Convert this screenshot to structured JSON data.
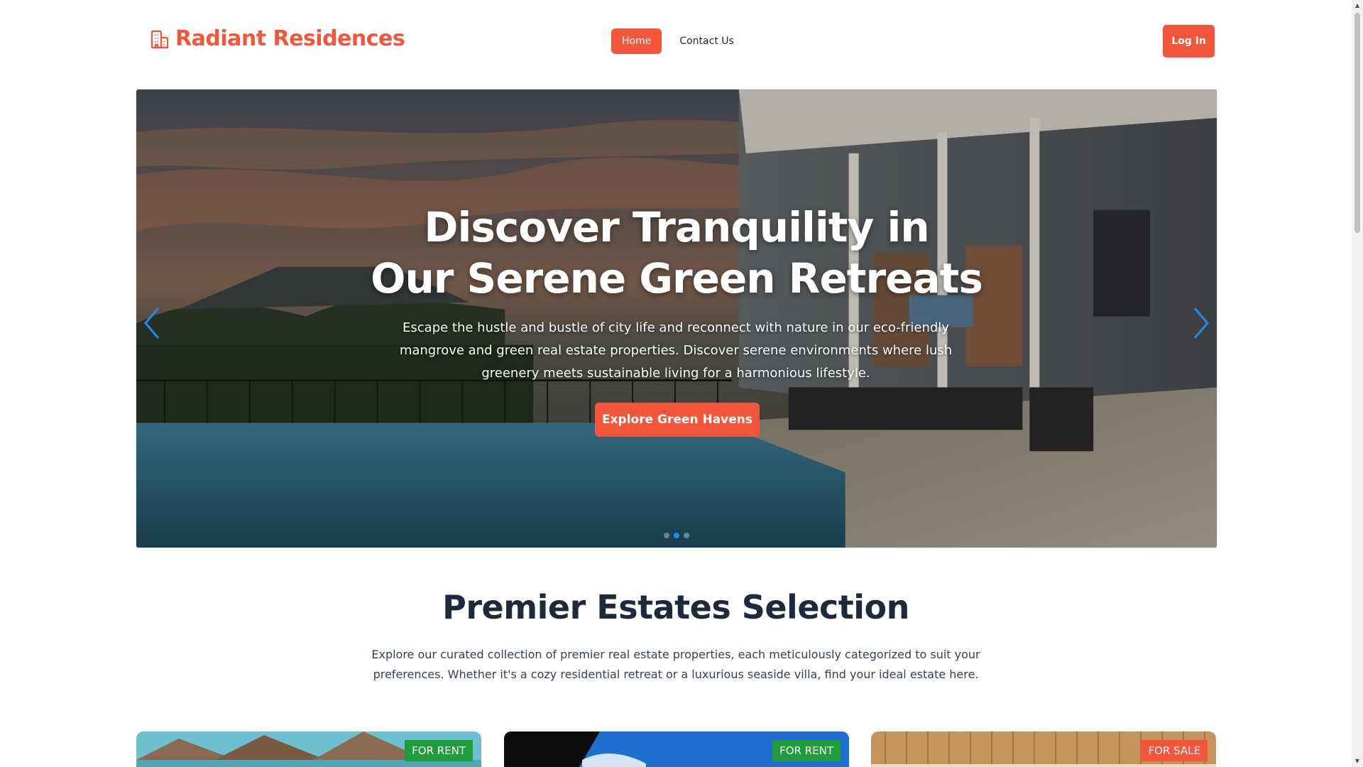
{
  "brand": {
    "name": "Radiant Residences",
    "icon": "building-icon",
    "color": "#f4563b"
  },
  "nav": {
    "items": [
      {
        "label": "Home",
        "active": true
      },
      {
        "label": "Contact Us",
        "active": false
      }
    ],
    "login_label": "Log In"
  },
  "hero": {
    "title_line1": "Discover Tranquility in",
    "title_line2": "Our Serene Green Retreats",
    "subtitle": "Escape the hustle and bustle of city life and reconnect with nature in our eco-friendly mangrove and green real estate properties. Discover serene environments where lush greenery meets sustainable living for a harmonious lifestyle.",
    "cta_label": "Explore Green Havens",
    "slide_count": 3,
    "active_slide": 2
  },
  "premier": {
    "title": "Premier Estates Selection",
    "description": "Explore our curated collection of premier real estate properties, each meticulously categorized to suit your preferences. Whether it's a cozy residential retreat or a luxurious seaside villa, find your ideal estate here."
  },
  "listings": [
    {
      "badge": "FOR RENT",
      "status": "rent"
    },
    {
      "badge": "FOR RENT",
      "status": "rent"
    },
    {
      "badge": "FOR SALE",
      "status": "sale"
    }
  ],
  "colors": {
    "accent": "#f4563b",
    "rent_badge": "#1f9d3a",
    "dot_active": "#1d8bf0"
  }
}
